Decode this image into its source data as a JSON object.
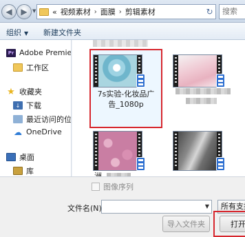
{
  "address": {
    "overflow": "«",
    "path": [
      "视频素材",
      "面膜",
      "剪辑素材"
    ],
    "search_placeholder": "搜索"
  },
  "toolbar": {
    "organize": "组织",
    "new_folder": "新建文件夹"
  },
  "sidebar": {
    "items": [
      {
        "label": "Adobe Premiere",
        "icon": "premiere-icon"
      },
      {
        "label": "工作区",
        "icon": "folder-icon"
      },
      {
        "label": "收藏夹",
        "icon": "star-icon"
      },
      {
        "label": "下载",
        "icon": "download-icon"
      },
      {
        "label": "最近访问的位置",
        "icon": "recent-icon"
      },
      {
        "label": "OneDrive",
        "icon": "cloud-icon"
      },
      {
        "label": "桌面",
        "icon": "desktop-icon"
      },
      {
        "label": "库",
        "icon": "library-icon"
      }
    ]
  },
  "files": {
    "selected_name_line1": "7s实验-化妆品广",
    "selected_name_line2": "告_1080p",
    "partial_label": "洲"
  },
  "bottom": {
    "image_sequence": "图像序列",
    "filename_label": "文件名(N):",
    "filename_value": "",
    "filter": "所有支持",
    "import_folder": "导入文件夹",
    "open": "打开"
  },
  "colors": {
    "highlight_red": "#d7262d",
    "video_badge": "#2d6fd1"
  }
}
